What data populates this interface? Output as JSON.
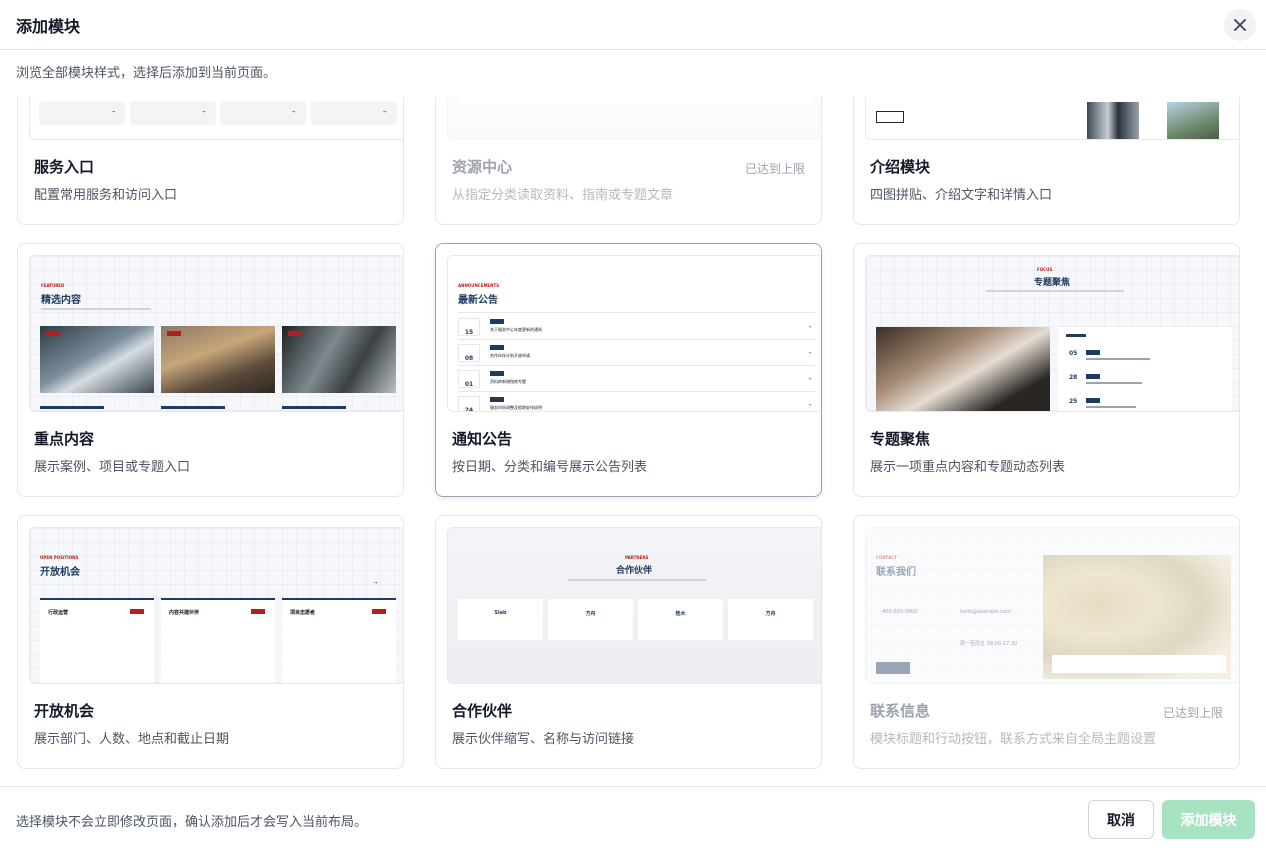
{
  "dialog": {
    "title": "添加模块",
    "subtitle": "浏览全部模块样式，选择后添加到当前页面。",
    "close_icon": "close-icon"
  },
  "cards": [
    {
      "title": "服务入口",
      "desc": "配置常用服务和访问入口",
      "status": ""
    },
    {
      "title": "资源中心",
      "desc": "从指定分类读取资料、指南或专题文章",
      "status": "已达到上限"
    },
    {
      "title": "介绍模块",
      "desc": "四图拼贴、介绍文字和详情入口",
      "status": ""
    },
    {
      "title": "重点内容",
      "desc": "展示案例、项目或专题入口",
      "status": ""
    },
    {
      "title": "通知公告",
      "desc": "按日期、分类和编号展示公告列表",
      "status": ""
    },
    {
      "title": "专题聚焦",
      "desc": "展示一项重点内容和专题动态列表",
      "status": ""
    },
    {
      "title": "开放机会",
      "desc": "展示部门、人数、地点和截止日期",
      "status": ""
    },
    {
      "title": "合作伙伴",
      "desc": "展示伙伴缩写、名称与访问链接",
      "status": ""
    },
    {
      "title": "联系信息",
      "desc": "模块标题和行动按钮，联系方式来自全局主题设置",
      "status": "已达到上限"
    }
  ],
  "previews": {
    "featured": {
      "title": "精选内容"
    },
    "notice": {
      "title": "最新公告",
      "items": [
        {
          "day": "15",
          "text": "关于服务中心年度更新的通知"
        },
        {
          "day": "08",
          "text": "合作伙伴计划开放申请"
        },
        {
          "day": "01",
          "text": "资料库新增指南专题"
        },
        {
          "day": "24",
          "text": "服务时间调整及假期安排说明"
        }
      ]
    },
    "focus": {
      "title": "专题聚焦",
      "dates": [
        "05",
        "28",
        "25"
      ]
    },
    "jobs": {
      "title": "开放机会",
      "columns": [
        "行政运营",
        "内容共建伙伴",
        "项目志愿者"
      ]
    },
    "partners": {
      "title": "合作伙伴",
      "items": [
        "Slab",
        "方舟",
        "桂木",
        "方舟"
      ]
    },
    "contact": {
      "title": "联系我们",
      "phone": "400-000-0000",
      "email": "hello@example.com",
      "hours": "周一至周五 09:00-17:30"
    }
  },
  "footer": {
    "note": "选择模块不会立即修改页面，确认添加后才会写入当前布局。",
    "cancel_label": "取消",
    "add_label": "添加模块"
  },
  "colors": {
    "accent": "#a7e3c1",
    "navy": "#1e3a5f",
    "red": "#b91c1c"
  }
}
